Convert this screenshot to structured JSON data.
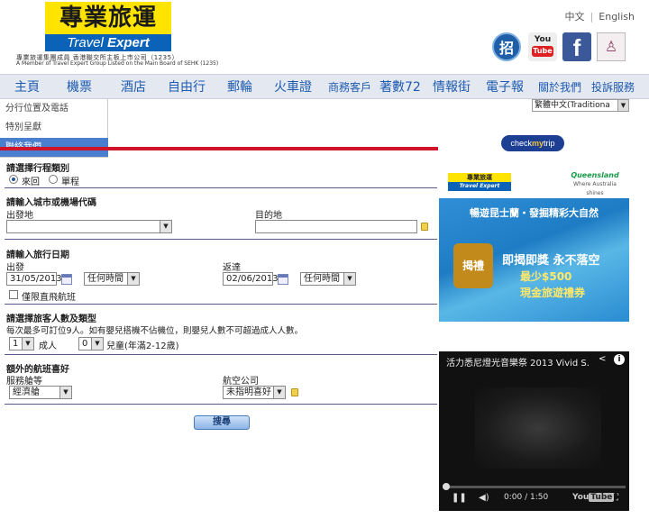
{
  "brand": {
    "logo_cn": "專業旅運",
    "logo_en_1": "Travel ",
    "logo_en_2": "Expert",
    "company_cn": "專業旅運集團成員  香港聯交所主板上市公司（1235）",
    "company_en": "A Member of Travel Expert Group   Listed on the Main Board of SEHK (1235)"
  },
  "lang": {
    "zh": "中文",
    "sep": "|",
    "en": "English"
  },
  "social": {
    "zhao": "招",
    "youtube_1": "You",
    "youtube_2": "Tube",
    "facebook": "f"
  },
  "nav": [
    "主頁",
    "機票",
    "酒店",
    "自由行",
    "郵輪",
    "火車證",
    "商務客戶",
    "著數72",
    "情報街",
    "電子報",
    "關於我們",
    "投訴服務"
  ],
  "submenu": [
    "分行位置及電話",
    "特別呈獻",
    "聯絡我們"
  ],
  "lang_select": "繁體中文(Traditiona",
  "form": {
    "trip_type_title": "請選擇行程類別",
    "roundtrip": "來回",
    "oneway": "單程",
    "city_title": "請輸入城市或機場代碼",
    "origin_label": "出發地",
    "origin_value": "",
    "dest_label": "目的地",
    "dest_value": "",
    "date_title": "請輸入旅行日期",
    "depart_label": "出發",
    "depart_date": "31/05/2013",
    "depart_time": "任何時間",
    "return_label": "返達",
    "return_date": "02/06/2013",
    "return_time": "任何時間",
    "direct_only": "僅限直飛航班",
    "pax_title": "請選擇旅客人數及類型",
    "pax_note": "每次最多可訂位9人。如有嬰兒搭機不佔機位，則嬰兒人數不可超過成人人數。",
    "adult_count": "1",
    "adult_label": "成人",
    "child_count": "0",
    "child_label": "兒童(年滿2-12歲)",
    "pref_title": "額外的航班喜好",
    "class_label": "服務艙等",
    "class_value": "經濟艙",
    "airline_label": "航空公司",
    "airline_value": "未指明喜好",
    "search_button": "搜尋"
  },
  "sidebar": {
    "checkmytrip_1": "check",
    "checkmytrip_2": "my",
    "checkmytrip_3": "trip",
    "mini_logo_cn": "專業旅運",
    "mini_logo_en": "Travel Expert",
    "queensland": "Queensland",
    "queensland_sub": "Where Australia shines",
    "ad_top": "暢遊昆士蘭・發掘精彩大自然",
    "ad_line1": "即揭即獎 永不落空",
    "ad_line2": "最少$500",
    "ad_line3": "現金旅遊禮券",
    "ad_badge": "揭禮",
    "video_title": "活力悉尼燈光音樂祭 2013 Vivid S...",
    "video_time": "0:00 / 1:50",
    "youtube_1": "You",
    "youtube_2": "Tube"
  }
}
